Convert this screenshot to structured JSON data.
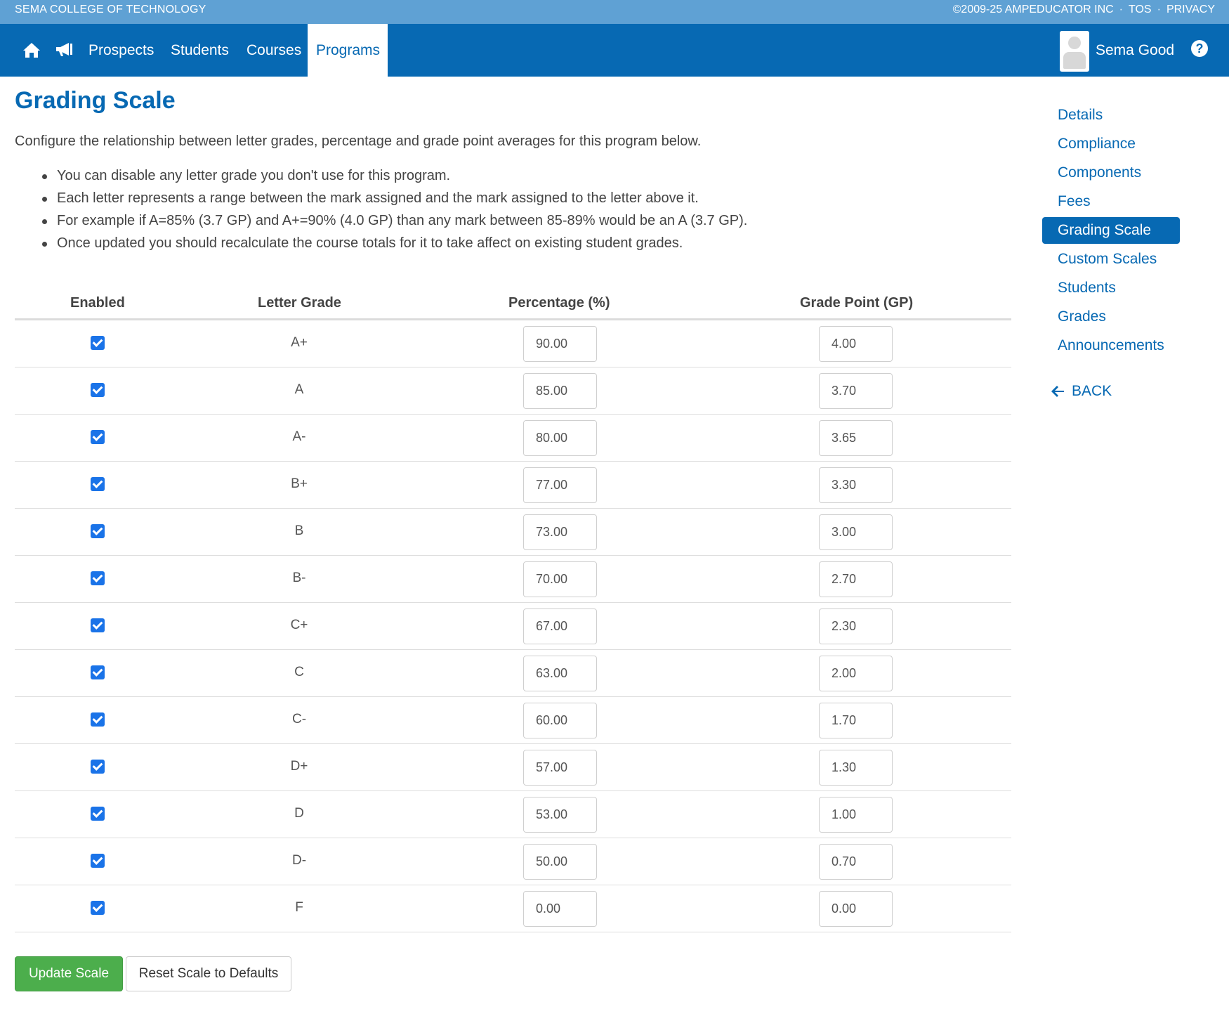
{
  "topbar": {
    "school": "SEMA COLLEGE OF TECHNOLOGY",
    "copyright": "©2009-25 AMPEDUCATOR INC",
    "tos": "TOS",
    "privacy": "PRIVACY",
    "separator": "·"
  },
  "nav": {
    "items": [
      {
        "label": "Prospects"
      },
      {
        "label": "Students"
      },
      {
        "label": "Courses"
      },
      {
        "label": "Programs"
      }
    ],
    "active": "Programs",
    "user_name": "Sema Good",
    "help": "?"
  },
  "page": {
    "title": "Grading Scale",
    "intro": "Configure the relationship between letter grades, percentage and grade point averages for this program below.",
    "bullets": [
      "You can disable any letter grade you don't use for this program.",
      "Each letter represents a range between the mark assigned and the mark assigned to the letter above it.",
      "For example if A=85% (3.7 GP) and A+=90% (4.0 GP) than any mark between 85-89% would be an A (3.7 GP).",
      "Once updated you should recalculate the course totals for it to take affect on existing student grades."
    ]
  },
  "table": {
    "headers": {
      "enabled": "Enabled",
      "letter": "Letter Grade",
      "percentage": "Percentage (%)",
      "grade_point": "Grade Point (GP)"
    },
    "rows": [
      {
        "enabled": true,
        "letter": "A+",
        "percentage": "90.00",
        "gp": "4.00"
      },
      {
        "enabled": true,
        "letter": "A",
        "percentage": "85.00",
        "gp": "3.70"
      },
      {
        "enabled": true,
        "letter": "A-",
        "percentage": "80.00",
        "gp": "3.65"
      },
      {
        "enabled": true,
        "letter": "B+",
        "percentage": "77.00",
        "gp": "3.30"
      },
      {
        "enabled": true,
        "letter": "B",
        "percentage": "73.00",
        "gp": "3.00"
      },
      {
        "enabled": true,
        "letter": "B-",
        "percentage": "70.00",
        "gp": "2.70"
      },
      {
        "enabled": true,
        "letter": "C+",
        "percentage": "67.00",
        "gp": "2.30"
      },
      {
        "enabled": true,
        "letter": "C",
        "percentage": "63.00",
        "gp": "2.00"
      },
      {
        "enabled": true,
        "letter": "C-",
        "percentage": "60.00",
        "gp": "1.70"
      },
      {
        "enabled": true,
        "letter": "D+",
        "percentage": "57.00",
        "gp": "1.30"
      },
      {
        "enabled": true,
        "letter": "D",
        "percentage": "53.00",
        "gp": "1.00"
      },
      {
        "enabled": true,
        "letter": "D-",
        "percentage": "50.00",
        "gp": "0.70"
      },
      {
        "enabled": true,
        "letter": "F",
        "percentage": "0.00",
        "gp": "0.00"
      }
    ]
  },
  "buttons": {
    "update": "Update Scale",
    "reset": "Reset Scale to Defaults"
  },
  "sidebar": {
    "items": [
      {
        "label": "Details"
      },
      {
        "label": "Compliance"
      },
      {
        "label": "Components"
      },
      {
        "label": "Fees"
      },
      {
        "label": "Grading Scale"
      },
      {
        "label": "Custom Scales"
      },
      {
        "label": "Students"
      },
      {
        "label": "Grades"
      },
      {
        "label": "Announcements"
      }
    ],
    "active": "Grading Scale",
    "back": "BACK"
  },
  "colors": {
    "topstrip": "#5fa1d4",
    "navbar": "#0769b3",
    "accent": "#0769b3",
    "update_button": "#4cae4c",
    "checkbox": "#1a73e8"
  },
  "icons": [
    "home-icon",
    "megaphone-icon",
    "user-avatar-icon",
    "help-icon",
    "back-arrow-icon",
    "checkbox-checked-icon"
  ]
}
